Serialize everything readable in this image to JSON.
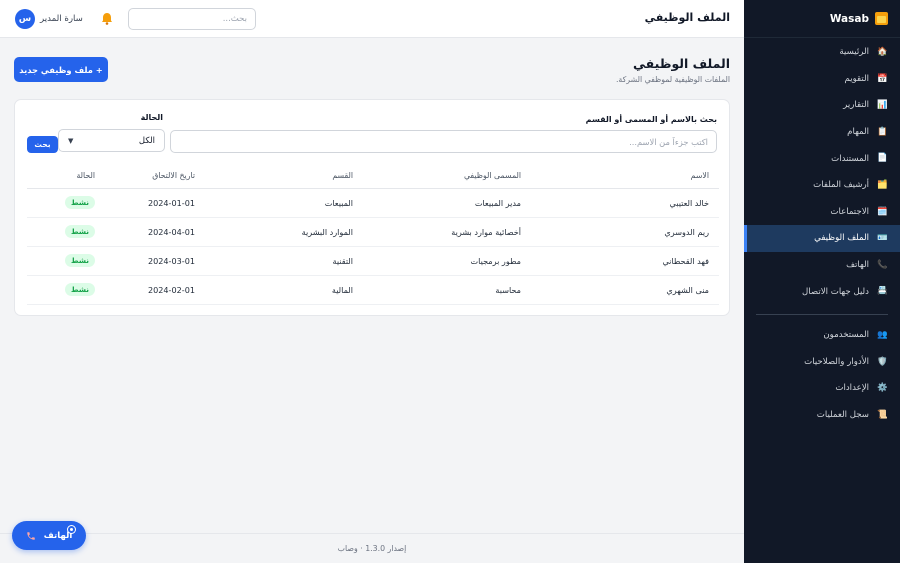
{
  "app": {
    "brand": "Wasab",
    "page_header_title": "الملف الوظيفي"
  },
  "sidebar": {
    "items": [
      {
        "label": "الرئيسية",
        "icon": "🏠"
      },
      {
        "label": "التقويم",
        "icon": "📅"
      },
      {
        "label": "التقارير",
        "icon": "📊"
      },
      {
        "label": "المهام",
        "icon": "📋"
      },
      {
        "label": "المستندات",
        "icon": "📄"
      },
      {
        "label": "أرشيف الملفات",
        "icon": "🗂️"
      },
      {
        "label": "الاجتماعات",
        "icon": "🗓️"
      },
      {
        "label": "الملف الوظيفي",
        "icon": "🪪"
      },
      {
        "label": "الهاتف",
        "icon": "📞"
      },
      {
        "label": "دليل جهات الاتصال",
        "icon": "📇"
      }
    ],
    "admin_items": [
      {
        "label": "المستخدمون",
        "icon": "👥"
      },
      {
        "label": "الأدوار والصلاحيات",
        "icon": "🛡️"
      },
      {
        "label": "الإعدادات",
        "icon": "⚙️"
      },
      {
        "label": "سجل العمليات",
        "icon": "📜"
      }
    ]
  },
  "topbar": {
    "search_placeholder": "بحث...",
    "user_name": "سارة المدير",
    "user_initial": "س"
  },
  "page": {
    "title": "الملف الوظيفي",
    "subtitle": "الملفات الوظيفية لموظفي الشركة.",
    "new_button": "+ ملف وظيفي جديد"
  },
  "filters": {
    "search_label": "بحث بالاسم أو المسمى أو القسم",
    "search_placeholder": "اكتب جزءاً من الاسم...",
    "status_label": "الحالة",
    "status_value": "الكل",
    "search_button": "بحث"
  },
  "table": {
    "headers": [
      "الاسم",
      "المسمى الوظيفي",
      "القسم",
      "تاريخ الالتحاق",
      "الحالة"
    ],
    "rows": [
      [
        "خالد العتيبي",
        "مدير المبيعات",
        "المبيعات",
        "2024-01-01",
        "نشط"
      ],
      [
        "ريم الدوسري",
        "أخصائية موارد بشرية",
        "الموارد البشرية",
        "2024-04-01",
        "نشط"
      ],
      [
        "فهد القحطاني",
        "مطور برمجيات",
        "التقنية",
        "2024-03-01",
        "نشط"
      ],
      [
        "منى الشهري",
        "محاسبة",
        "المالية",
        "2024-02-01",
        "نشط"
      ]
    ]
  },
  "footer": {
    "text": "إصدار 1.3.0 · وصاب"
  },
  "phone_fab": {
    "label": "الهاتف"
  },
  "colors": {
    "accent": "#2563eb",
    "sidebar_bg": "#111827",
    "active_bg": "#1e3a5f",
    "badge_green": "#16a34a"
  }
}
